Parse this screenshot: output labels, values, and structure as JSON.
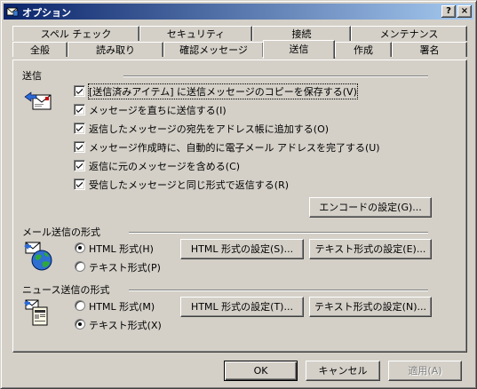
{
  "window": {
    "title": "オプション",
    "help_label": "?",
    "close_label": "×"
  },
  "tabs_back": [
    {
      "label": "スペル チェック"
    },
    {
      "label": "セキュリティ"
    },
    {
      "label": "接続"
    },
    {
      "label": "メンテナンス"
    }
  ],
  "tabs_front": [
    {
      "label": "全般"
    },
    {
      "label": "読み取り"
    },
    {
      "label": "確認メッセージ"
    },
    {
      "label": "送信",
      "active": true
    },
    {
      "label": "作成"
    },
    {
      "label": "署名"
    }
  ],
  "send_group": {
    "label": "送信",
    "options": [
      {
        "label": "[送信済みアイテム] に送信メッセージのコピーを保存する(V)",
        "checked": true
      },
      {
        "label": "メッセージを直ちに送信する(I)",
        "checked": true
      },
      {
        "label": "返信したメッセージの宛先をアドレス帳に追加する(O)",
        "checked": true
      },
      {
        "label": "メッセージ作成時に、自動的に電子メール アドレスを完了する(U)",
        "checked": true
      },
      {
        "label": "返信に元のメッセージを含める(C)",
        "checked": true
      },
      {
        "label": "受信したメッセージと同じ形式で返信する(R)",
        "checked": true
      }
    ],
    "encode_button": "エンコードの設定(G)..."
  },
  "mail_format": {
    "label": "メール送信の形式",
    "radio_html": "HTML 形式(H)",
    "radio_text": "テキスト形式(P)",
    "selected": "html",
    "html_settings": "HTML 形式の設定(S)...",
    "text_settings": "テキスト形式の設定(E)..."
  },
  "news_format": {
    "label": "ニュース送信の形式",
    "radio_html": "HTML 形式(M)",
    "radio_text": "テキスト形式(X)",
    "selected": "text",
    "html_settings": "HTML 形式の設定(T)...",
    "text_settings": "テキスト形式の設定(N)..."
  },
  "footer": {
    "ok": "OK",
    "cancel": "キャンセル",
    "apply": "適用(A)"
  }
}
